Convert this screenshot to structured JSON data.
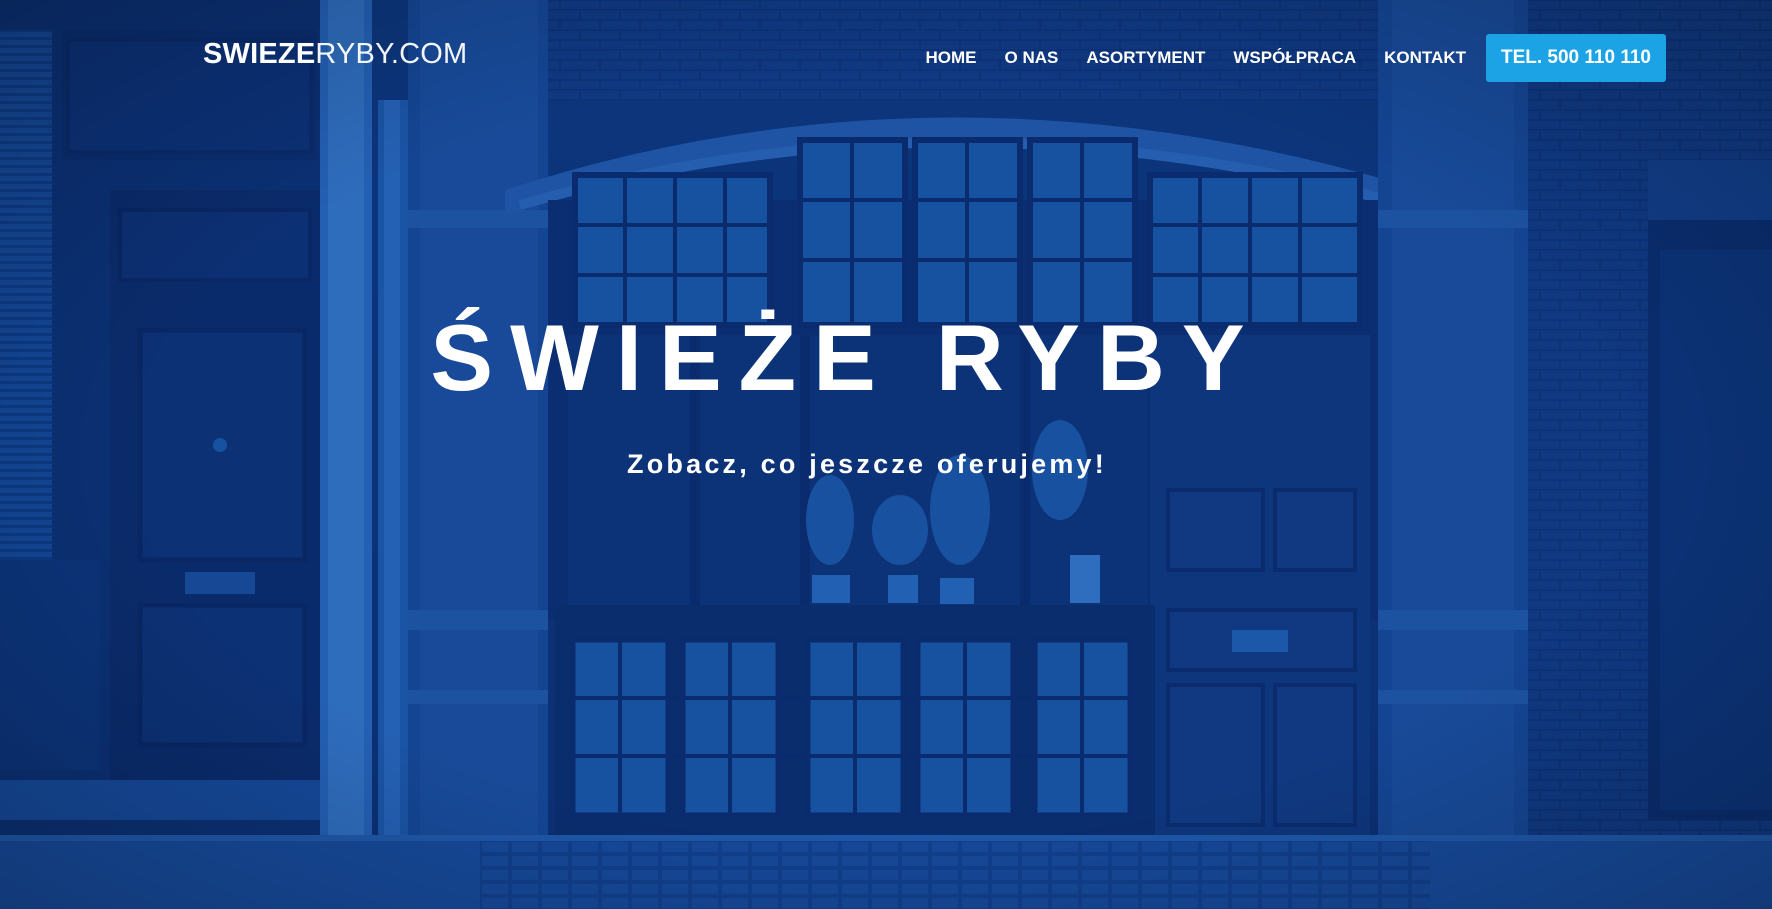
{
  "header": {
    "logo_bold": "SWIEZE",
    "logo_light": "RYBY.COM",
    "nav": [
      {
        "label": "HOME"
      },
      {
        "label": "O NAS"
      },
      {
        "label": "ASORTYMENT"
      },
      {
        "label": "WSPÓŁPRACA"
      },
      {
        "label": "KONTAKT"
      }
    ],
    "phone_button": "TEL. 500 110 110"
  },
  "hero": {
    "title": "ŚWIEŻE RYBY",
    "subtitle": "Zobacz, co jeszcze oferujemy!",
    "background": "storefront-photo"
  },
  "colors": {
    "overlay": "#0a3a8c",
    "accent": "#1ba3e6",
    "text": "#ffffff"
  }
}
